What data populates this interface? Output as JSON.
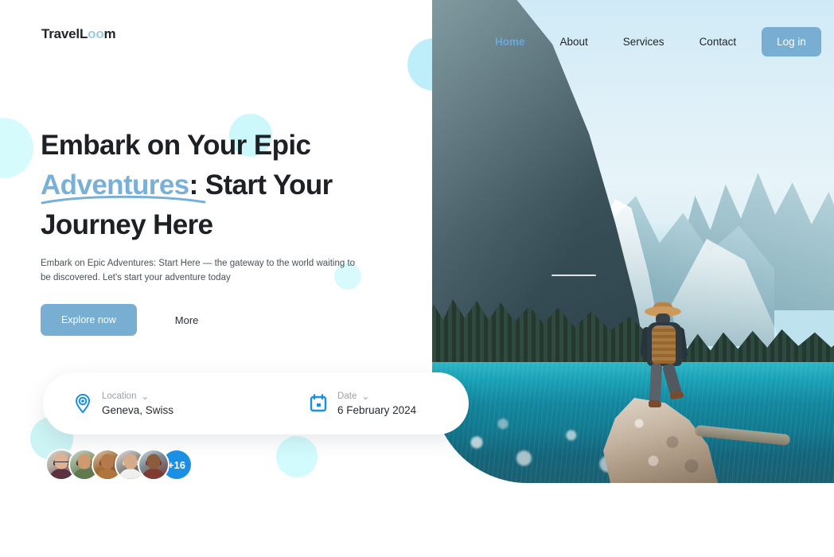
{
  "brand": {
    "name_part1": "TravelL",
    "name_accent": "oo",
    "name_part3": "m",
    "accent_color": "#9ccbe8"
  },
  "nav": {
    "links": [
      {
        "label": "Home",
        "active": true
      },
      {
        "label": "About",
        "active": false
      },
      {
        "label": "Services",
        "active": false
      },
      {
        "label": "Contact",
        "active": false
      }
    ],
    "login_label": "Log in",
    "active_color": "#6aa9d9",
    "button_color": "#78aed2"
  },
  "hero_text": {
    "line1": "Embark on Your Epic",
    "accent": "Adventures",
    "line2_rest": ": Start Your",
    "line3": "Journey Here",
    "subtitle": "Embark on Epic Adventures: Start Here — the gateway to the world waiting to be discovered. Let's start your adventure today",
    "primary_cta": "Explore now",
    "secondary_cta": "More",
    "accent_color": "#79b0d8"
  },
  "booking": {
    "location": {
      "icon": "location-pin-icon",
      "label": "Location",
      "caret": "⌄",
      "value": "Geneva, Swiss"
    },
    "date": {
      "icon": "calendar-icon",
      "label": "Date",
      "caret": "⌄",
      "value": "6 February 2024"
    }
  },
  "social_proof": {
    "avatar_count": 5,
    "avatars": [
      "avatar-1",
      "avatar-2",
      "avatar-3",
      "avatar-4",
      "avatar-5"
    ],
    "overflow_badge": "+16",
    "badge_color": "#1a8fe3"
  },
  "hero_image": {
    "alt": "Hiker in straw hat standing on rock overlooking turquoise mountain lake"
  },
  "decor": {
    "circle_color_pale": "#d6fbfd",
    "circle_color_blue": "#bfeefb"
  }
}
